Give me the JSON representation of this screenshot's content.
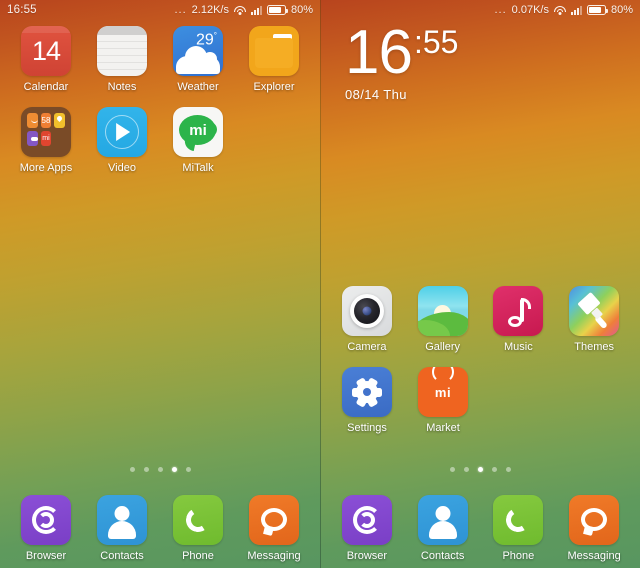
{
  "screens": [
    {
      "name": "home-screen-left",
      "status_bar": {
        "clock": "16:55",
        "dots": "...",
        "network_speed": "2.12K/s",
        "wifi_icon": "wifi-icon",
        "signal_icon": "signal-icon",
        "battery_icon": "battery-icon",
        "battery_level": "80%"
      },
      "apps": [
        [
          {
            "label": "Calendar",
            "icon": "calendar-icon",
            "day": "14"
          },
          {
            "label": "Notes",
            "icon": "notes-icon"
          },
          {
            "label": "Weather",
            "icon": "weather-icon",
            "temperature": "29",
            "degree": "°"
          },
          {
            "label": "Explorer",
            "icon": "folder-icon"
          }
        ],
        [
          {
            "label": "More Apps",
            "icon": "app-folder-icon",
            "mini": [
              "58",
              "mi"
            ]
          },
          {
            "label": "Video",
            "icon": "play-icon"
          },
          {
            "label": "MiTalk",
            "icon": "mitalk-icon",
            "logo": "mi"
          }
        ]
      ],
      "page_dots": {
        "count": 5,
        "active": 4
      },
      "dock": [
        {
          "label": "Browser",
          "icon": "browser-icon"
        },
        {
          "label": "Contacts",
          "icon": "contacts-icon"
        },
        {
          "label": "Phone",
          "icon": "phone-icon"
        },
        {
          "label": "Messaging",
          "icon": "message-icon"
        }
      ]
    },
    {
      "name": "home-screen-right",
      "status_bar": {
        "clock": "",
        "dots": "...",
        "network_speed": "0.07K/s",
        "wifi_icon": "wifi-icon",
        "signal_icon": "signal-icon",
        "battery_icon": "battery-icon",
        "battery_level": "80%"
      },
      "clock_widget": {
        "hours": "16",
        "minutes": ":55",
        "date": "08/14  Thu"
      },
      "apps": [
        [
          {
            "label": "Camera",
            "icon": "camera-icon"
          },
          {
            "label": "Gallery",
            "icon": "gallery-icon"
          },
          {
            "label": "Music",
            "icon": "music-note-icon"
          },
          {
            "label": "Themes",
            "icon": "paintbrush-icon"
          }
        ],
        [
          {
            "label": "Settings",
            "icon": "gear-icon"
          },
          {
            "label": "Market",
            "icon": "shopping-bag-icon",
            "logo": "mi"
          }
        ]
      ],
      "page_dots": {
        "count": 5,
        "active": 3
      },
      "dock": [
        {
          "label": "Browser",
          "icon": "browser-icon"
        },
        {
          "label": "Contacts",
          "icon": "contacts-icon"
        },
        {
          "label": "Phone",
          "icon": "phone-icon"
        },
        {
          "label": "Messaging",
          "icon": "message-icon"
        }
      ]
    }
  ],
  "colors": {
    "bg_top": "#b8441e",
    "bg_mid": "#c9a02c",
    "bg_bottom": "#589660",
    "calendar": "#d94a36",
    "weather": "#3478d4",
    "explorer": "#f2a61b",
    "video": "#2aaee6",
    "mitalk": "#2cb44a",
    "music": "#d21f55",
    "settings": "#4273cc",
    "market": "#ef6420",
    "browser": "#8244cc",
    "contacts": "#3399db",
    "phone": "#78c134",
    "messaging": "#ea6a1e"
  }
}
